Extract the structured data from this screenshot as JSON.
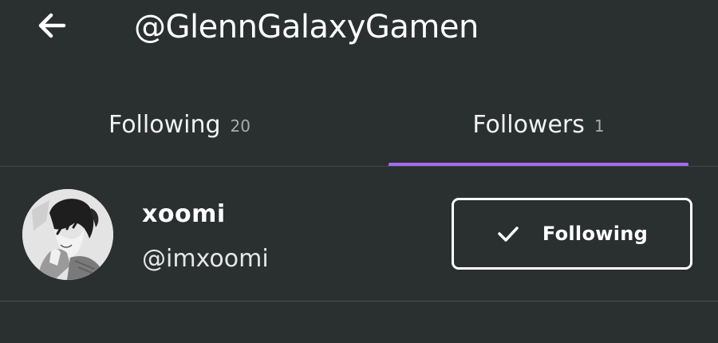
{
  "header": {
    "title": "@GlennGalaxyGamen",
    "back_icon": "arrow-left-icon"
  },
  "tabs": [
    {
      "label": "Following",
      "count": "20",
      "active": false
    },
    {
      "label": "Followers",
      "count": "1",
      "active": true
    }
  ],
  "colors": {
    "background": "#2a2f30",
    "accent": "#a46cf0",
    "text": "#ffffff",
    "muted": "#a7acad"
  },
  "followers": [
    {
      "display_name": "xoomi",
      "handle": "@imxoomi",
      "button_label": "Following",
      "button_icon": "checkmark-icon"
    }
  ]
}
